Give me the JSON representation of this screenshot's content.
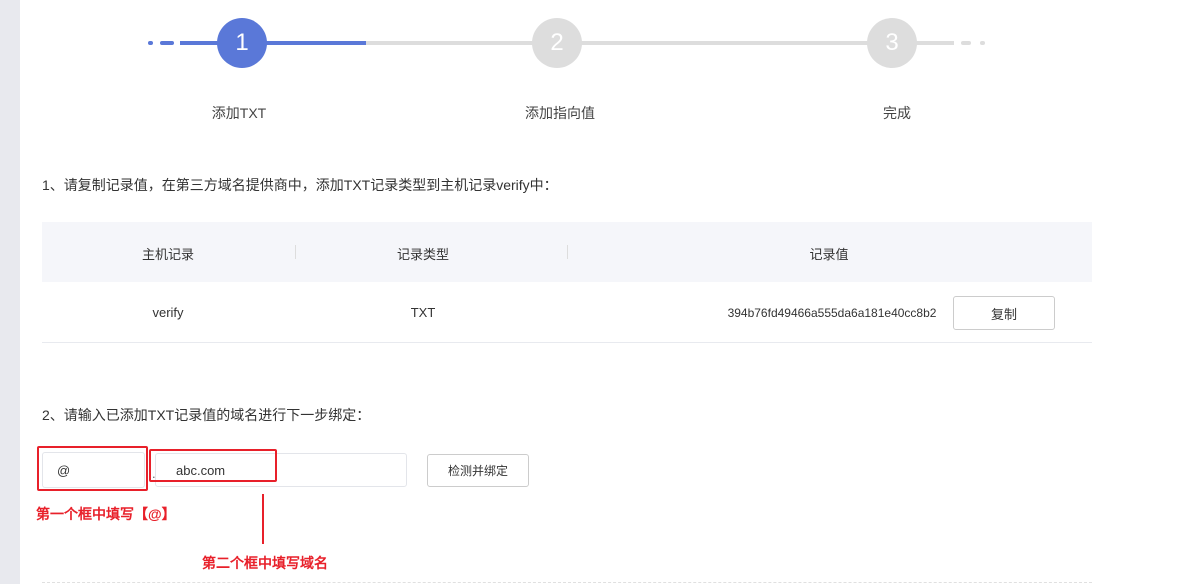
{
  "steps": [
    {
      "num": "1",
      "label": "添加TXT",
      "state": "active"
    },
    {
      "num": "2",
      "label": "添加指向值",
      "state": "pending"
    },
    {
      "num": "3",
      "label": "完成",
      "state": "pending"
    }
  ],
  "colors": {
    "accent": "#5a78d8",
    "pending": "#dddddd",
    "annotation": "#e8202a"
  },
  "instruction1": "1、请复制记录值，在第三方域名提供商中，添加TXT记录类型到主机记录verify中：",
  "table": {
    "headers": [
      "主机记录",
      "记录类型",
      "记录值"
    ],
    "row": {
      "host": "verify",
      "type": "TXT",
      "value": "394b76fd49466a555da6a181e40cc8b2",
      "copy_label": "复制"
    }
  },
  "instruction2": "2、请输入已添加TXT记录值的域名进行下一步绑定：",
  "form": {
    "prefix_value": "@",
    "separator": ".",
    "domain_value": "abc.com",
    "submit_label": "检测并绑定"
  },
  "annotations": {
    "first": "第一个框中填写【@】",
    "second": "第二个框中填写域名"
  }
}
